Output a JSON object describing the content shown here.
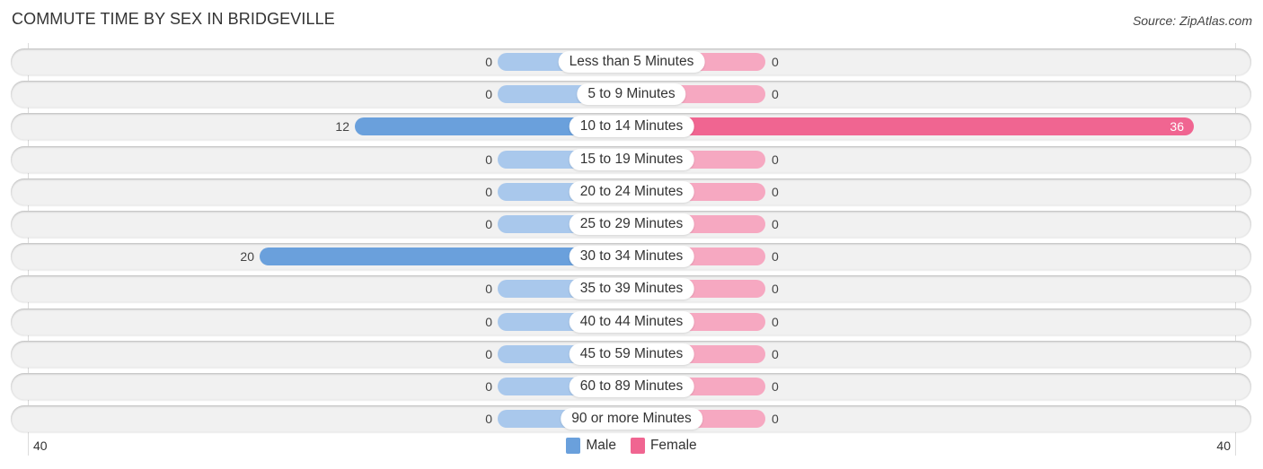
{
  "header": {
    "title": "COMMUTE TIME BY SEX IN BRIDGEVILLE",
    "source": "Source: ZipAtlas.com"
  },
  "colors": {
    "male": "#6aa0dc",
    "male_zero": "#a9c8ec",
    "female": "#f06591",
    "female_zero": "#f6a8c1",
    "track": "#f1f1f1"
  },
  "chart_data": {
    "type": "bar",
    "orientation": "horizontal-diverging",
    "title": "COMMUTE TIME BY SEX IN BRIDGEVILLE",
    "categories": [
      "Less than 5 Minutes",
      "5 to 9 Minutes",
      "10 to 14 Minutes",
      "15 to 19 Minutes",
      "20 to 24 Minutes",
      "25 to 29 Minutes",
      "30 to 34 Minutes",
      "35 to 39 Minutes",
      "40 to 44 Minutes",
      "45 to 59 Minutes",
      "60 to 89 Minutes",
      "90 or more Minutes"
    ],
    "series": [
      {
        "name": "Male",
        "side": "left",
        "values": [
          0,
          0,
          12,
          0,
          0,
          0,
          20,
          0,
          0,
          0,
          0,
          0
        ]
      },
      {
        "name": "Female",
        "side": "right",
        "values": [
          0,
          0,
          36,
          0,
          0,
          0,
          0,
          0,
          0,
          0,
          0,
          0
        ]
      }
    ],
    "axis": {
      "left_label": "40",
      "right_label": "40",
      "max": 40
    },
    "legend": {
      "position": "bottom-center",
      "entries": [
        "Male",
        "Female"
      ]
    },
    "grid": false
  }
}
